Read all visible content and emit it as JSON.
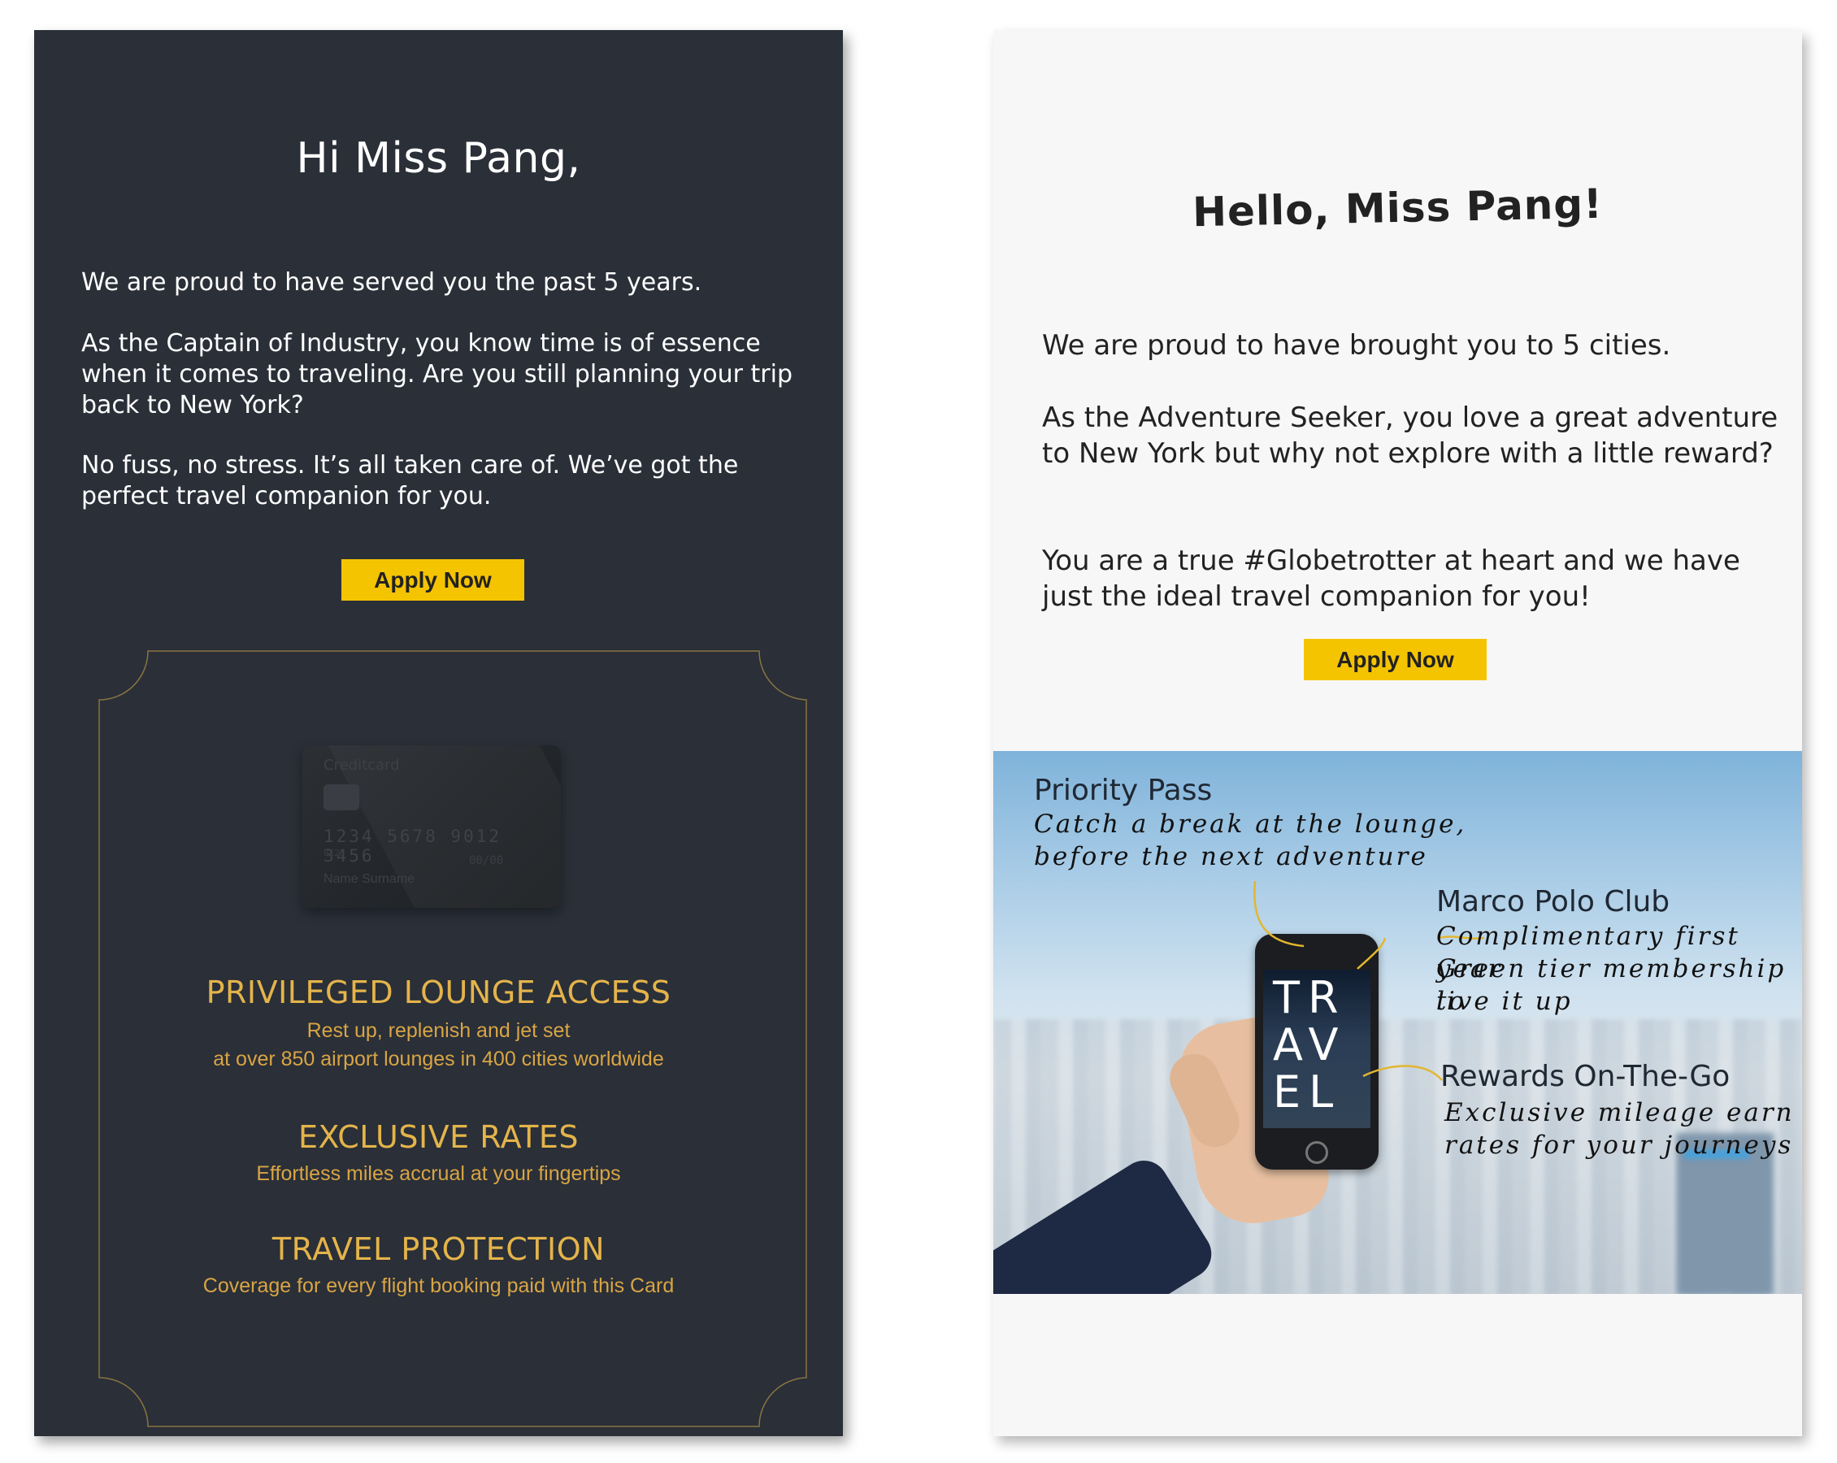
{
  "left_email": {
    "greeting": "Hi Miss Pang,",
    "paragraphs": [
      "We are proud to have served you the past 5 years.",
      "As the Captain of Industry, you know time is of essence when it comes to traveling. Are you still planning your trip back to New York?",
      "No fuss, no stress. It’s all taken care of.  We’ve got the perfect travel companion for you."
    ],
    "apply_label": "Apply Now",
    "card": {
      "brand": "Creditcard",
      "number": "1234  5678  9012  3456",
      "small_digits": "0123",
      "expiry": "00/00",
      "name": "Name Surname"
    },
    "benefits": [
      {
        "title": "PRIVILEGED LOUNGE ACCESS",
        "desc_line1": "Rest up, replenish and jet set",
        "desc_line2": "at over 850 airport lounges in 400 cities worldwide"
      },
      {
        "title": "EXCLUSIVE RATES",
        "desc_line1": "Effortless miles accrual at your fingertips"
      },
      {
        "title": "TRAVEL PROTECTION",
        "desc_line1": "Coverage for every flight booking paid with this Card"
      }
    ],
    "colors": {
      "background": "#2a2f38",
      "accent": "#e4b44a",
      "button": "#f5c400"
    }
  },
  "right_email": {
    "greeting": "Hello, Miss Pang!",
    "paragraphs": [
      "We are proud to have brought you to 5 cities.",
      "As the Adventure Seeker, you love a great adventure to New York but why not explore with a little reward?",
      "You are a true #Globetrotter at heart and we have just the ideal travel companion for you!"
    ],
    "apply_label": "Apply Now",
    "phone_text": [
      "TR",
      "AV",
      "EL"
    ],
    "features": [
      {
        "title": "Priority Pass",
        "desc_lines": [
          "Catch a break at the lounge,",
          "before the next adventure"
        ]
      },
      {
        "title": "Marco Polo Club",
        "desc_lines": [
          "Complimentary first year",
          "Green tier membership to",
          "live it up"
        ]
      },
      {
        "title": "Rewards On-The-Go",
        "desc_lines": [
          "Exclusive mileage earn",
          "rates for your journeys"
        ]
      }
    ],
    "colors": {
      "background": "#f7f7f7",
      "button": "#f5c400",
      "callout_line": "#e2b630"
    }
  }
}
